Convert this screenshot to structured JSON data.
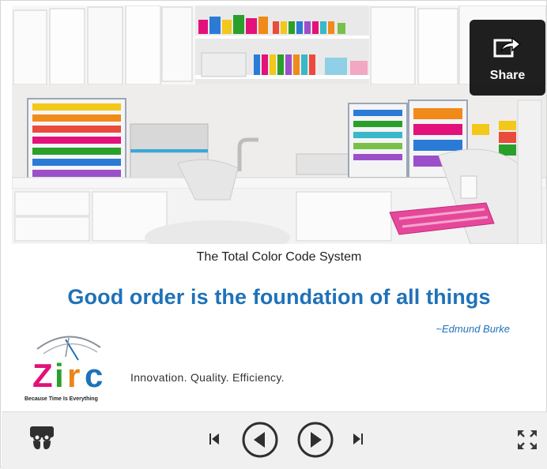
{
  "slide": {
    "subtitle": "The Total Color Code System",
    "quote": "Good order is the foundation of all things",
    "author": "~Edmund Burke",
    "motto": "Innovation. Quality. Efficiency.",
    "logo": {
      "letters": [
        "Z",
        "i",
        "r",
        "c"
      ],
      "tagline": "Because Time Is Everything"
    }
  },
  "share": {
    "label": "Share",
    "icon": "share-icon"
  },
  "controls": {
    "logo_icon": "slideshare-icon",
    "first": "skip-to-first-icon",
    "previous": "previous-slide-icon",
    "next": "next-slide-icon",
    "last": "skip-to-last-icon",
    "fullscreen": "fullscreen-icon"
  },
  "colors": {
    "quote_blue": "#1f72b8",
    "logo_magenta": "#e2127a",
    "logo_green": "#2aa02a",
    "logo_orange": "#e9861a",
    "control_bar": "#f0f0f0"
  }
}
